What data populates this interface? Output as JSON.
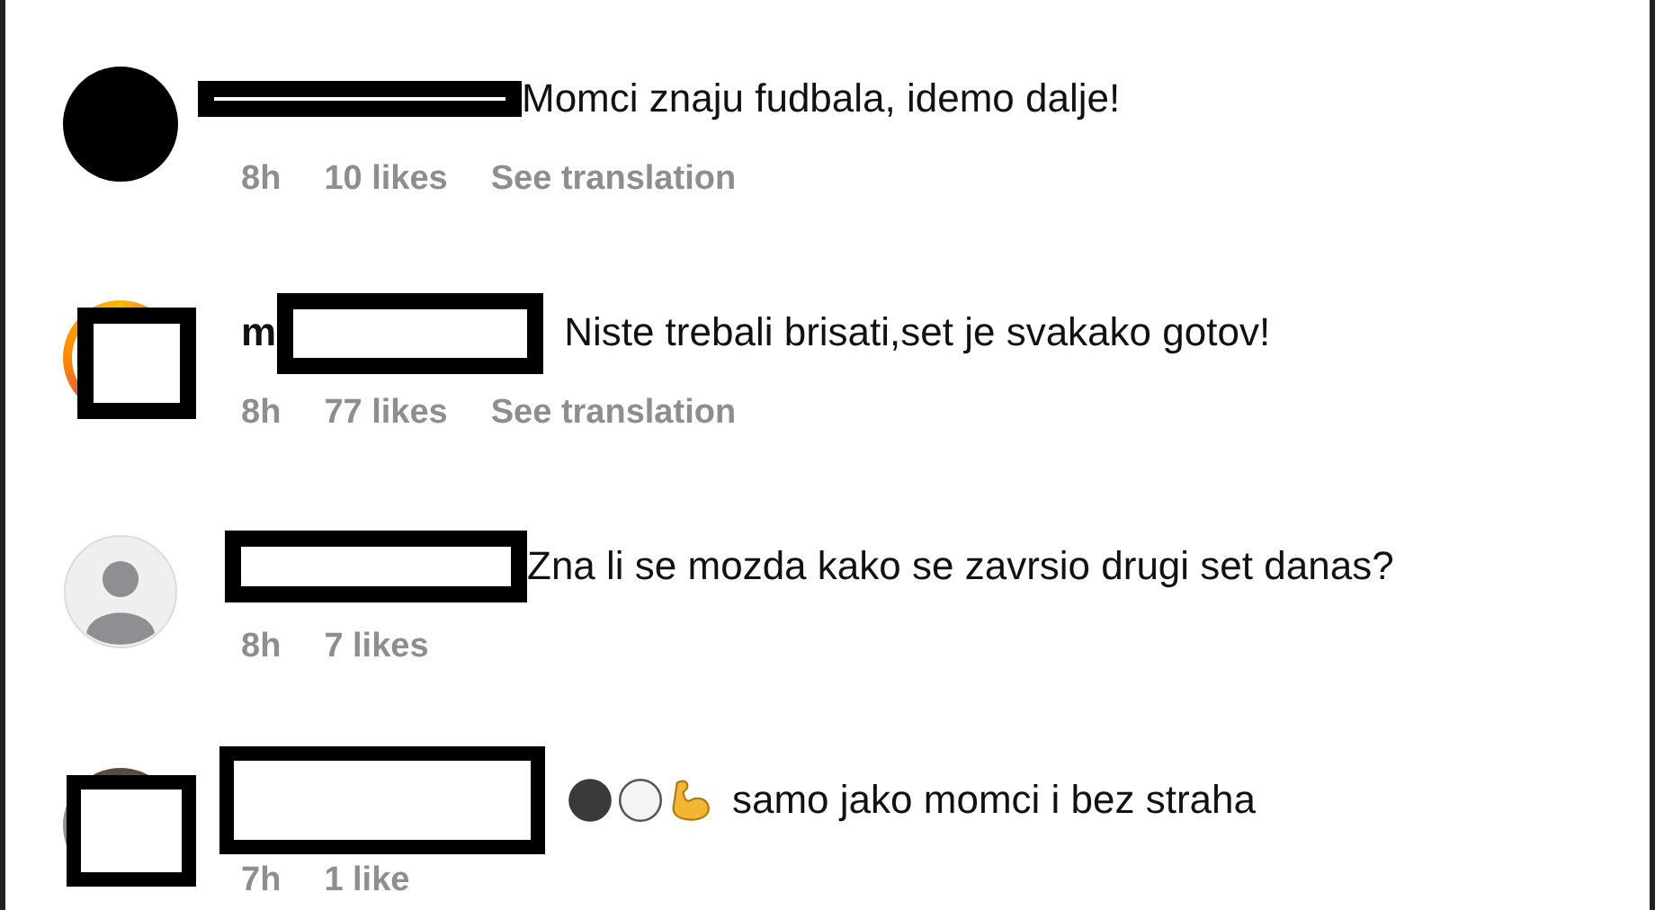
{
  "comments": [
    {
      "avatar": {
        "kind": "filled"
      },
      "avatar_redacted": false,
      "name_redaction": {
        "kind": "bar"
      },
      "leading_icons": false,
      "text": "Momci znaju fudbala, idemo dalje!",
      "time": "8h",
      "likes": "10 likes",
      "translation": "See translation"
    },
    {
      "avatar": {
        "kind": "story"
      },
      "avatar_redacted": true,
      "name_prefix": "m",
      "name_redaction": {
        "kind": "box"
      },
      "leading_icons": false,
      "text": "Niste trebali brisati,set je svakako gotov!",
      "time": "8h",
      "likes": "77 likes",
      "translation": "See translation"
    },
    {
      "avatar": {
        "kind": "default"
      },
      "avatar_redacted": false,
      "name_redaction": {
        "kind": "box"
      },
      "leading_icons": false,
      "text": "Zna li se mozda kako se zavrsio drugi set danas?",
      "time": "8h",
      "likes": "7 likes"
    },
    {
      "avatar": {
        "kind": "photo"
      },
      "avatar_redacted": true,
      "name_redaction": {
        "kind": "tall"
      },
      "leading_icons": true,
      "text": "samo jako momci i bez straha",
      "time": "7h",
      "likes": "1 like"
    }
  ]
}
